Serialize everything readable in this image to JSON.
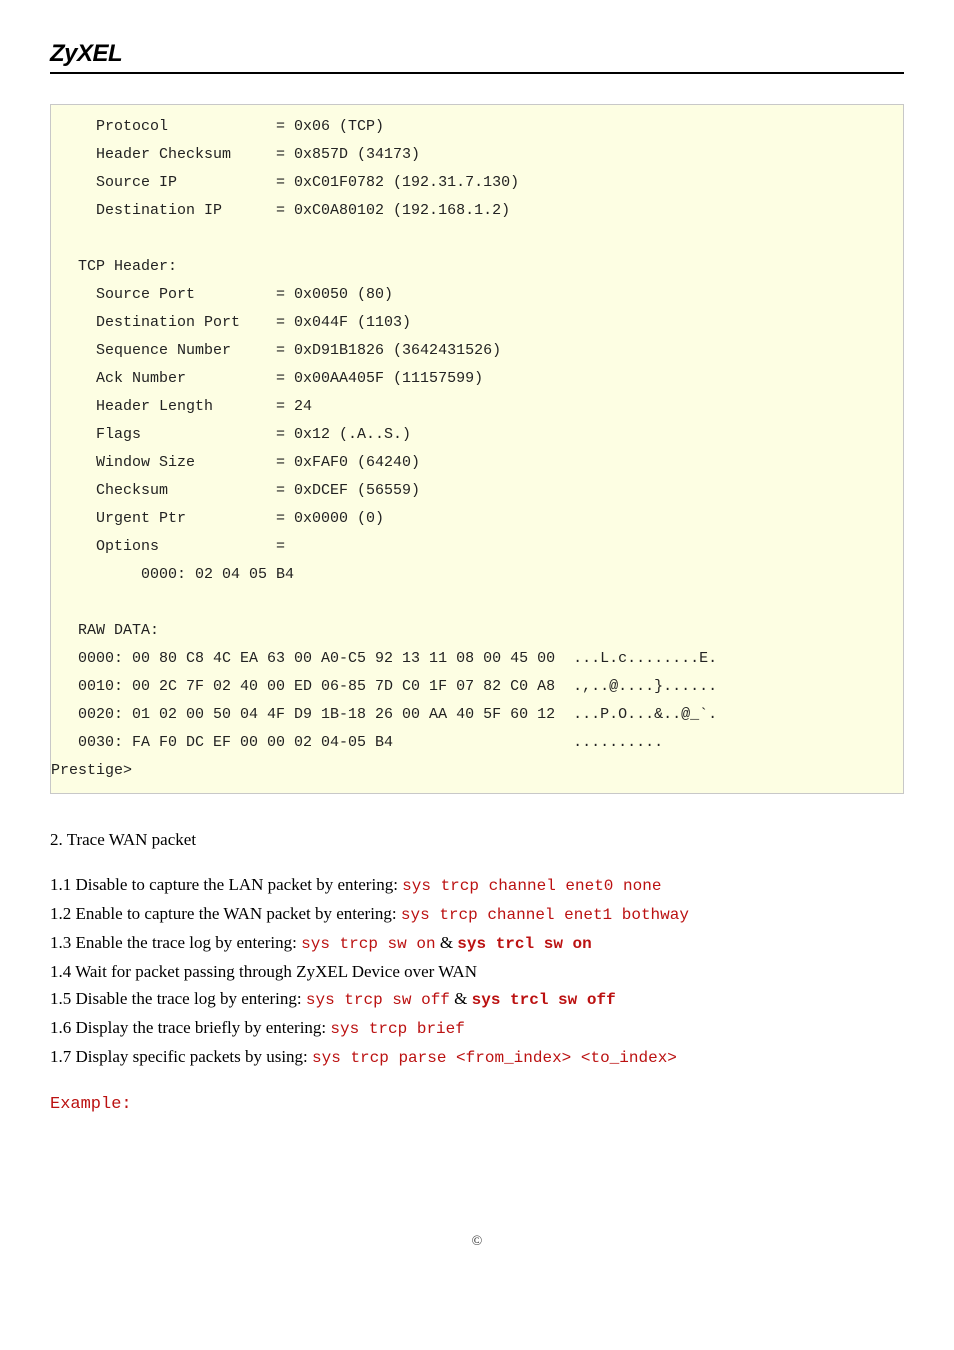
{
  "header": {
    "logo": "ZyXEL"
  },
  "codeblock": "     Protocol            = 0x06 (TCP)\n     Header Checksum     = 0x857D (34173)\n     Source IP           = 0xC01F0782 (192.31.7.130)\n     Destination IP      = 0xC0A80102 (192.168.1.2)\n\n   TCP Header:\n     Source Port         = 0x0050 (80)\n     Destination Port    = 0x044F (1103)\n     Sequence Number     = 0xD91B1826 (3642431526)\n     Ack Number          = 0x00AA405F (11157599)\n     Header Length       = 24\n     Flags               = 0x12 (.A..S.)\n     Window Size         = 0xFAF0 (64240)\n     Checksum            = 0xDCEF (56559)\n     Urgent Ptr          = 0x0000 (0)\n     Options             =\n          0000: 02 04 05 B4\n\n   RAW DATA:\n   0000: 00 80 C8 4C EA 63 00 A0-C5 92 13 11 08 00 45 00  ...L.c........E.\n   0010: 00 2C 7F 02 40 00 ED 06-85 7D C0 1F 07 82 C0 A8  .,..@....}......\n   0020: 01 02 00 50 04 4F D9 1B-18 26 00 AA 40 5F 60 12  ...P.O...&..@_`.\n   0030: FA F0 DC EF 00 00 02 04-05 B4                    ..........\nPrestige>",
  "section_title": "2. Trace WAN packet",
  "steps": {
    "s1": {
      "pre": "1.1 Disable to capture the LAN packet by entering: ",
      "cmd": "sys trcp channel enet0 none"
    },
    "s2": {
      "pre": "1.2 Enable to capture the WAN packet by entering: ",
      "cmd": "sys trcp channel enet1 bothway"
    },
    "s3": {
      "pre": "1.3 Enable the trace log by entering: ",
      "cmd1": "sys trcp sw on",
      "amp": " & ",
      "cmd2": "sys trcl sw on"
    },
    "s4": {
      "pre": "1.4 Wait for packet passing through ZyXEL Device over WAN"
    },
    "s5": {
      "pre": "1.5 Disable the trace log by entering: ",
      "cmd1": "sys trcp sw off",
      "amp": " & ",
      "cmd2": "sys trcl sw off"
    },
    "s6": {
      "pre": "1.6 Display the trace briefly by entering: ",
      "cmd": "sys trcp brief"
    },
    "s7": {
      "pre": "1.7 Display specific packets by using: ",
      "cmd": "sys trcp parse <from_index> <to_index>"
    }
  },
  "example_heading": "Example:",
  "footer": "©"
}
